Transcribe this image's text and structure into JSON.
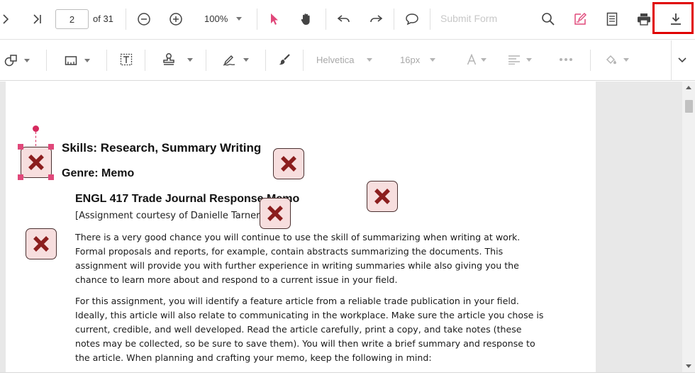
{
  "toolbar": {
    "current_page": "2",
    "page_count_label": "of 31",
    "zoom_level": "100%",
    "submit_form_label": "Submit Form"
  },
  "format_toolbar": {
    "font_family": "Helvetica",
    "font_size": "16px"
  },
  "document": {
    "heading_skills": "Skills: Research, Summary Writing",
    "heading_genre": "Genre: Memo",
    "title": "ENGL 417 Trade Journal Response Memo",
    "courtesy": "[Assignment courtesy of Danielle Tarner]",
    "paragraph1_lines": [
      "There is a very good chance you will continue to use the skill of summarizing when writing at work.",
      "Formal proposals and reports, for example, contain abstracts summarizing the documents.  This",
      "assignment will provide you with further experience in writing summaries while also giving you the",
      "chance to learn more about and respond to a current issue in your field."
    ],
    "paragraph2_lines": [
      "For this assignment, you will identify a feature article from a reliable trade publication in your field.",
      "Ideally, this article will also relate to communicating in the workplace. Make sure the article you chose is",
      "current, credible, and well developed. Read the article carefully, print a copy, and take notes (these",
      "notes may be collected, so be sure to save them).  You will then write a brief summary and response to",
      "the article. When planning and crafting your memo, keep the following in mind:"
    ]
  },
  "icons": {
    "accent": "#e0487a",
    "download_highlight": "#e00000",
    "stamp_fill": "#f7dede",
    "stamp_cross": "#8b1e1e"
  }
}
